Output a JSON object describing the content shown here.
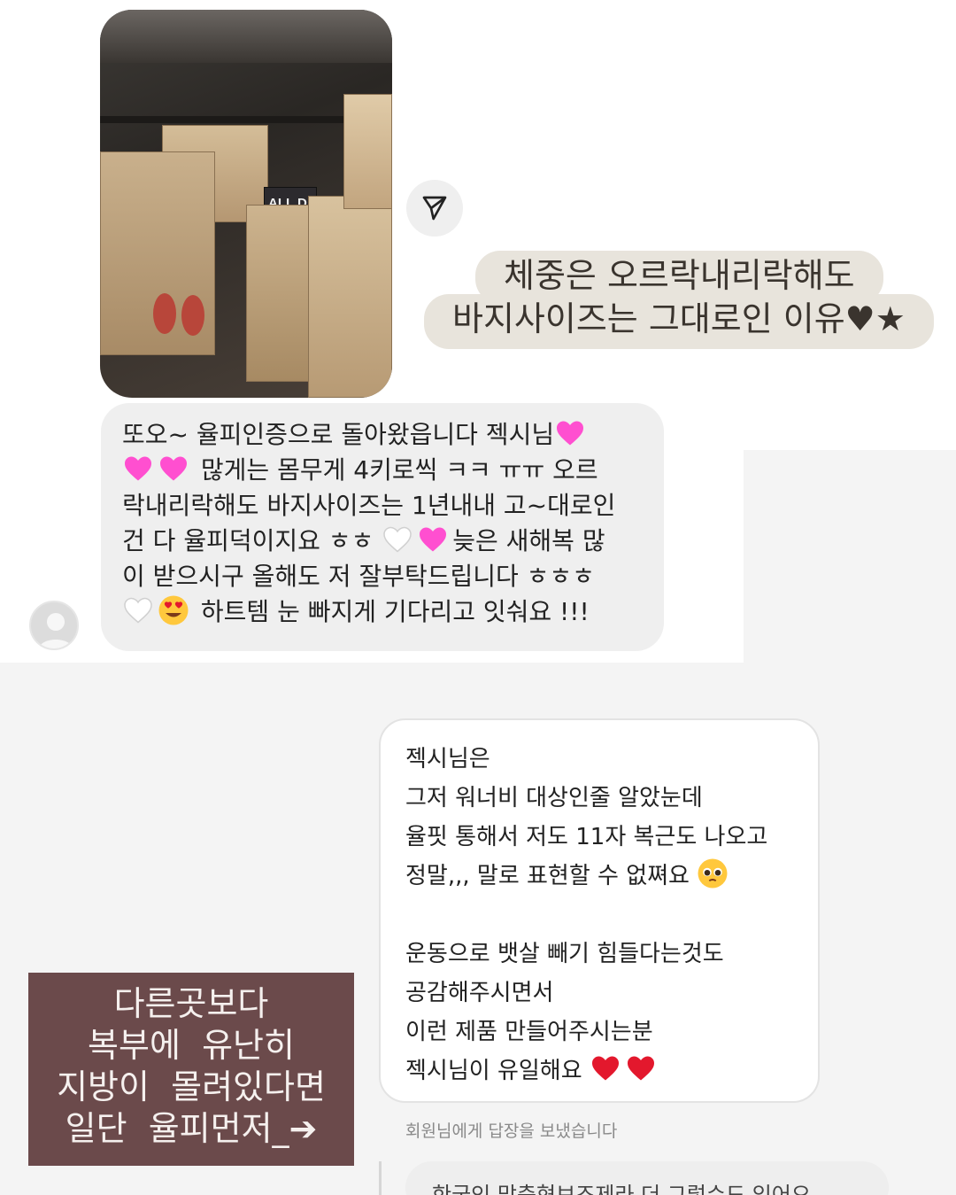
{
  "product_photo": {
    "box_label": "ALL DAY\nSLIM"
  },
  "caption": {
    "line1": "체중은 오르락내리락해도",
    "line2": "바지사이즈는 그대로인 이유♥★"
  },
  "incoming_message": {
    "lines": [
      "또오~ 율피인증으로 돌아왔읍니다 젝시님",
      "많게는 몸무게 4키로씩 ㅋㅋ ㅠㅠ  오르",
      "락내리락해도 바지사이즈는 1년내내 고~대로인",
      "건 다 율피덕이지요 ㅎㅎ",
      "늦은 새해복 많",
      "이 받으시구 올해도 저 잘부탁드립니다 ㅎㅎㅎ",
      "하트템 눈 빠지게 기다리고 잇숴요 !!!"
    ]
  },
  "overlay": {
    "lines": [
      "다른곳보다",
      "복부에  유난히",
      "지방이  몰려있다면",
      "일단  율피먼저_➔"
    ]
  },
  "reply": {
    "lines": [
      "젝시님은",
      "그저 워너비 대상인줄 알았눈데",
      "율핏 통해서 저도 11자 복근도 나오고",
      "정말,,, 말로 표현할 수 없쪄요",
      "",
      "운동으로 뱃살 빼기 힘들다는것도",
      "공감해주시면서",
      "이런 제품 만들어주시는분",
      "젝시님이 유일해요"
    ],
    "status": "회원님에게 답장을 보냈습니다",
    "next_preview": "한국인 맞춤형보조제라 더 그렇수도 있어요"
  },
  "colors": {
    "caption_bg": "#e8e4dc",
    "overlay_bg": "#6b4a4b",
    "incoming_bubble": "#efefef",
    "heart_pink": "#ff4fd0",
    "heart_red": "#e3182d"
  },
  "icons": [
    "send-arrow-icon",
    "pink-heart-icon",
    "white-heart-icon",
    "heart-eyes-icon",
    "pleading-face-icon",
    "red-heart-icon",
    "default-avatar-icon"
  ]
}
